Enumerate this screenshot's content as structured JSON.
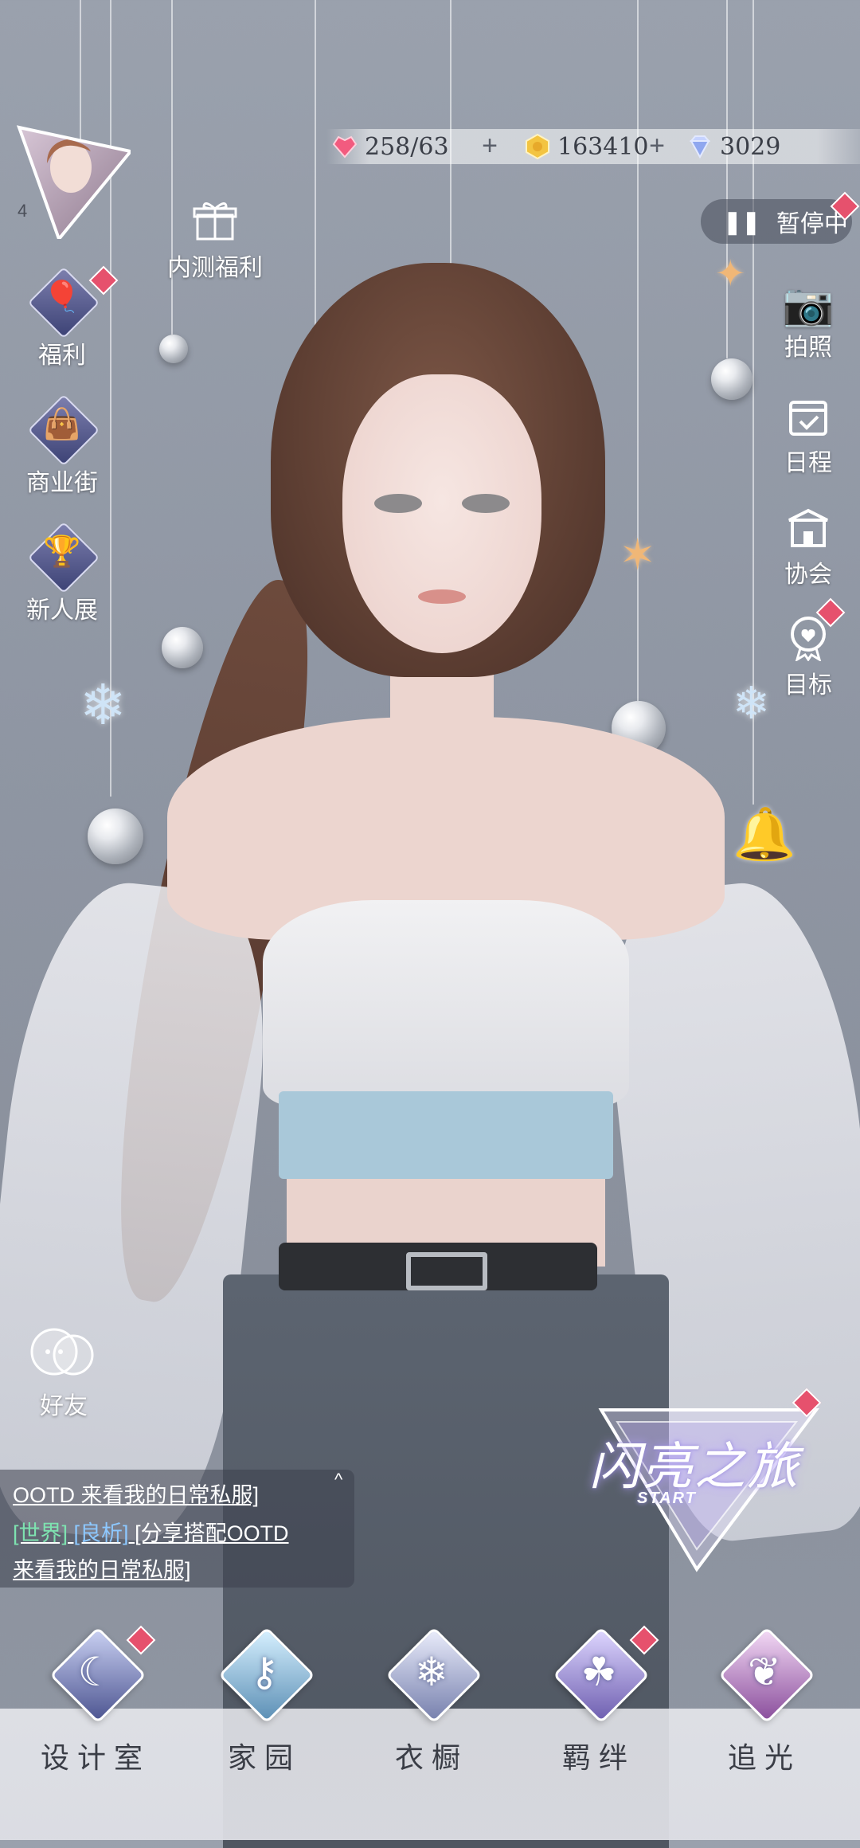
{
  "currency": {
    "stamina": "258/63",
    "gold": "163410",
    "diamond": "3029",
    "stamina_icon": "heart-gem-icon",
    "gold_icon": "gold-coin-icon",
    "diamond_icon": "diamond-icon"
  },
  "player": {
    "level": "4"
  },
  "events": {
    "beta_welfare": "内测福利"
  },
  "left_menu": [
    {
      "label": "福利",
      "icon": "hot-air-balloon-icon"
    },
    {
      "label": "商业街",
      "icon": "shopping-bag-icon"
    },
    {
      "label": "新人展",
      "icon": "trophy-icon"
    }
  ],
  "friends": {
    "label": "好友",
    "icon": "friends-icon"
  },
  "pause": {
    "label": "暂停中"
  },
  "right_menu": [
    {
      "label": "拍照",
      "icon": "camera-icon"
    },
    {
      "label": "日程",
      "icon": "calendar-icon"
    },
    {
      "label": "协会",
      "icon": "guild-icon"
    },
    {
      "label": "目标",
      "icon": "goal-medal-icon"
    }
  ],
  "chat": {
    "line1": "OOTD 来看我的日常私服]",
    "channel": "[世界]",
    "user": "[良析]",
    "line2_msg": "[分享搭配OOTD",
    "line3": "来看我的日常私服]"
  },
  "start": {
    "title": "闪亮之旅",
    "subtitle": "START"
  },
  "bottom_nav": [
    {
      "label": "设计室",
      "icon": "moon-icon"
    },
    {
      "label": "家园",
      "icon": "key-icon"
    },
    {
      "label": "衣橱",
      "icon": "snowflake-icon"
    },
    {
      "label": "羁绊",
      "icon": "clover-icon"
    },
    {
      "label": "追光",
      "icon": "butterfly-icon"
    }
  ]
}
